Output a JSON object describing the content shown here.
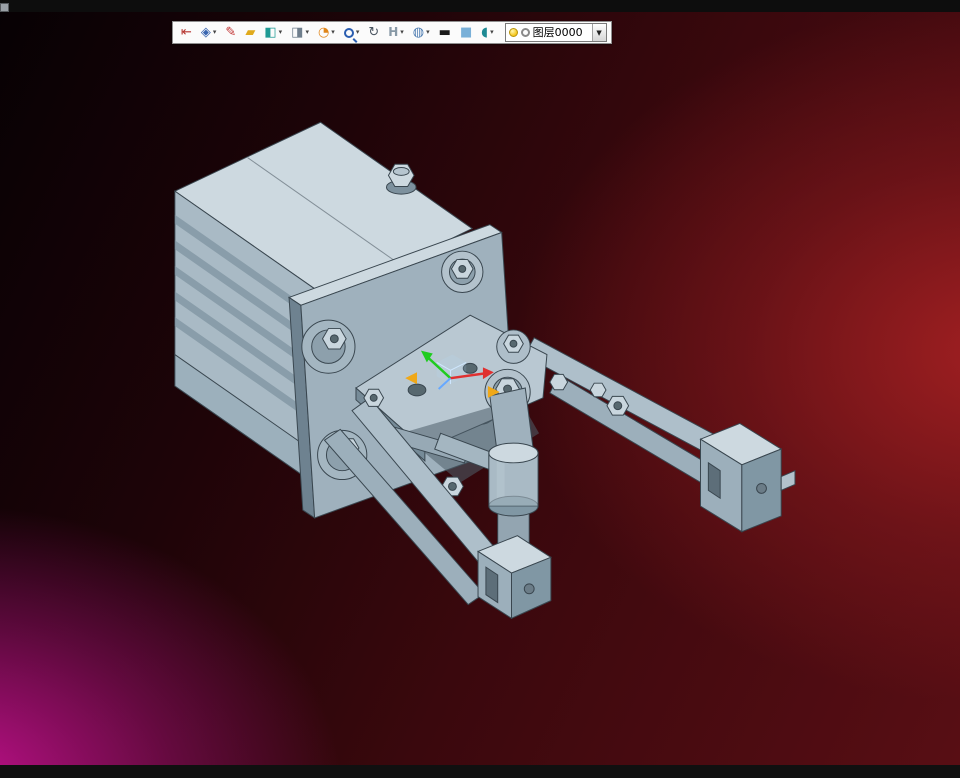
{
  "window": {
    "top_bar_color": "#0d0d0d",
    "bottom_bar_color": "#101010"
  },
  "toolbar": {
    "caret": "▾",
    "items": [
      {
        "icon": "exit-door-icon",
        "glyph": "⇤",
        "dropdown": false
      },
      {
        "icon": "view-cube-icon",
        "glyph": "◈",
        "dropdown": true
      },
      {
        "icon": "pencil-icon",
        "glyph": "✎",
        "dropdown": false
      },
      {
        "icon": "yellow-block-icon",
        "glyph": "▰",
        "dropdown": false
      },
      {
        "icon": "teal-cube-icon",
        "glyph": "◧",
        "dropdown": true
      },
      {
        "icon": "white-cube-icon",
        "glyph": "◨",
        "dropdown": true
      },
      {
        "icon": "orange-pie-icon",
        "glyph": "◔",
        "dropdown": true
      },
      {
        "icon": "magnifier-icon",
        "glyph": "",
        "dropdown": true
      },
      {
        "icon": "rotate-view-icon",
        "glyph": "↻",
        "dropdown": false
      },
      {
        "icon": "grid-h-icon",
        "glyph": "H",
        "dropdown": true
      },
      {
        "icon": "render-sphere-icon",
        "glyph": "◍",
        "dropdown": true
      },
      {
        "icon": "line-width-icon",
        "glyph": "▬",
        "dropdown": false
      },
      {
        "icon": "color-swatch-icon",
        "glyph": "■",
        "dropdown": false
      },
      {
        "icon": "shaded-view-icon",
        "glyph": "◖",
        "dropdown": true
      }
    ],
    "layer_selector": {
      "value": "图层0000",
      "caret": "▼",
      "bulb_color": "#f5c518"
    }
  },
  "viewport": {
    "background": {
      "top_left": "#0a0205",
      "right_glow": "#8c1d22",
      "bottom_left_glow": "#a31280",
      "bottom_right": "#4a0c14"
    },
    "model": {
      "name": "pneumatic-gripper-assembly",
      "body_color": "#a9bac5",
      "highlight_color": "#cdd9e0",
      "shadow_color": "#8097a4",
      "edge_color": "#39464f",
      "triad": {
        "x_axis_color": "#e03030",
        "y_axis_color": "#1fcc1f",
        "z_axis_color": "#66a8ff",
        "handle_color": "#f0a818"
      }
    }
  }
}
